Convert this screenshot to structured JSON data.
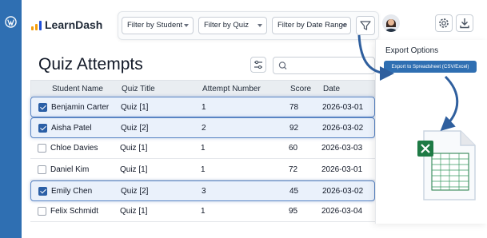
{
  "brand": {
    "name": "LearnDash"
  },
  "filters": [
    {
      "label": "Filter by Student"
    },
    {
      "label": "Filter by Quiz"
    },
    {
      "label": "Filter by Date Range"
    }
  ],
  "page": {
    "title": "Quiz Attempts"
  },
  "search": {
    "placeholder": ""
  },
  "table": {
    "headers": [
      "Student Name",
      "Quiz Title",
      "Attempt Number",
      "Score",
      "Date"
    ],
    "rows": [
      {
        "selected": true,
        "student": "Benjamin Carter",
        "quiz": "Quiz [1]",
        "attempt": "1",
        "score": "78",
        "date": "2026-03-01"
      },
      {
        "selected": true,
        "student": "Aisha Patel",
        "quiz": "Quiz [2]",
        "attempt": "2",
        "score": "92",
        "date": "2026-03-02"
      },
      {
        "selected": false,
        "student": "Chloe Davies",
        "quiz": "Quiz [1]",
        "attempt": "1",
        "score": "60",
        "date": "2026-03-03"
      },
      {
        "selected": false,
        "student": "Daniel Kim",
        "quiz": "Quiz [1]",
        "attempt": "1",
        "score": "72",
        "date": "2026-03-01"
      },
      {
        "selected": true,
        "student": "Emily Chen",
        "quiz": "Quiz [2]",
        "attempt": "3",
        "score": "45",
        "date": "2026-03-02"
      },
      {
        "selected": false,
        "student": "Felix Schmidt",
        "quiz": "Quiz [1]",
        "attempt": "1",
        "score": "95",
        "date": "2026-03-04"
      }
    ]
  },
  "export": {
    "title": "Export Options",
    "button_label": "Export to Spreadsheet (CSV/Excel)"
  },
  "icons": {
    "wordpress": "wordpress-icon",
    "filter": "funnel-icon",
    "settings": "gear-icon",
    "download": "download-icon",
    "columns": "sliders-icon",
    "search": "search-icon",
    "spreadsheet": "excel-file-icon"
  },
  "colors": {
    "sidebar": "#2f6fb2",
    "accent": "#2b5fa6",
    "selected_row": "#eaf1fb",
    "brand_orange": "#f59e0b",
    "excel_green": "#1e7a45"
  }
}
